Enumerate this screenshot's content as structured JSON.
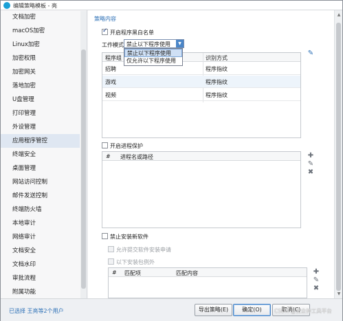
{
  "window": {
    "title": "编辑策略模板 - 亮"
  },
  "sidebar": {
    "items": [
      {
        "label": "文档加密"
      },
      {
        "label": "macOS加密"
      },
      {
        "label": "Linux加密"
      },
      {
        "label": "加密权限"
      },
      {
        "label": "加密网关"
      },
      {
        "label": "落地加密"
      },
      {
        "label": "U盘管理"
      },
      {
        "label": "打印管理"
      },
      {
        "label": "外设管理"
      },
      {
        "label": "应用程序管控"
      },
      {
        "label": "终端安全"
      },
      {
        "label": "桌面管理"
      },
      {
        "label": "网站访问控制"
      },
      {
        "label": "邮件发送控制"
      },
      {
        "label": "终端防火墙"
      },
      {
        "label": "本地审计"
      },
      {
        "label": "网络审计"
      },
      {
        "label": "文档安全"
      },
      {
        "label": "文档水印"
      },
      {
        "label": "审批流程"
      },
      {
        "label": "附属功能"
      }
    ],
    "active_index": 9
  },
  "content": {
    "section_title": "策略内容",
    "whitelist_checkbox": {
      "label": "开启程序黑白名单",
      "checked": true
    },
    "work_mode": {
      "label": "工作模式",
      "value": "禁止以下程序使用",
      "options": [
        "禁止以下程序使用",
        "仅允许以下程序使用"
      ],
      "selected_index": 0
    },
    "program_table": {
      "headers": [
        "程序组",
        "识别方式"
      ],
      "rows": [
        {
          "group": "招聘",
          "method": "程序指纹"
        },
        {
          "group": "游戏",
          "method": "程序指纹"
        },
        {
          "group": "视频",
          "method": "程序指纹"
        }
      ]
    },
    "process_protect_checkbox": {
      "label": "开启进程保护",
      "checked": false
    },
    "process_table": {
      "headers": [
        "#",
        "进程名或路径"
      ]
    },
    "block_install_checkbox": {
      "label": "禁止安装新软件",
      "checked": false
    },
    "allow_submit_checkbox": {
      "label": "允许提交软件安装申请",
      "checked": false
    },
    "exceptions_checkbox": {
      "label": "以下安装包例外",
      "checked": false
    },
    "exceptions_table": {
      "headers": [
        "#",
        "匹配项",
        "匹配内容"
      ]
    }
  },
  "footer": {
    "status": "已选择 王亮等2个用户",
    "export_label": "导出策略(E)",
    "ok_label": "确定(O)",
    "cancel_label": "取消(C)",
    "watermark": "CSDN @安企神工具平台"
  },
  "colors": {
    "accent": "#2b6fb6",
    "selected_row": "#edf4fb",
    "dropdown_button": "#4a86c8"
  }
}
